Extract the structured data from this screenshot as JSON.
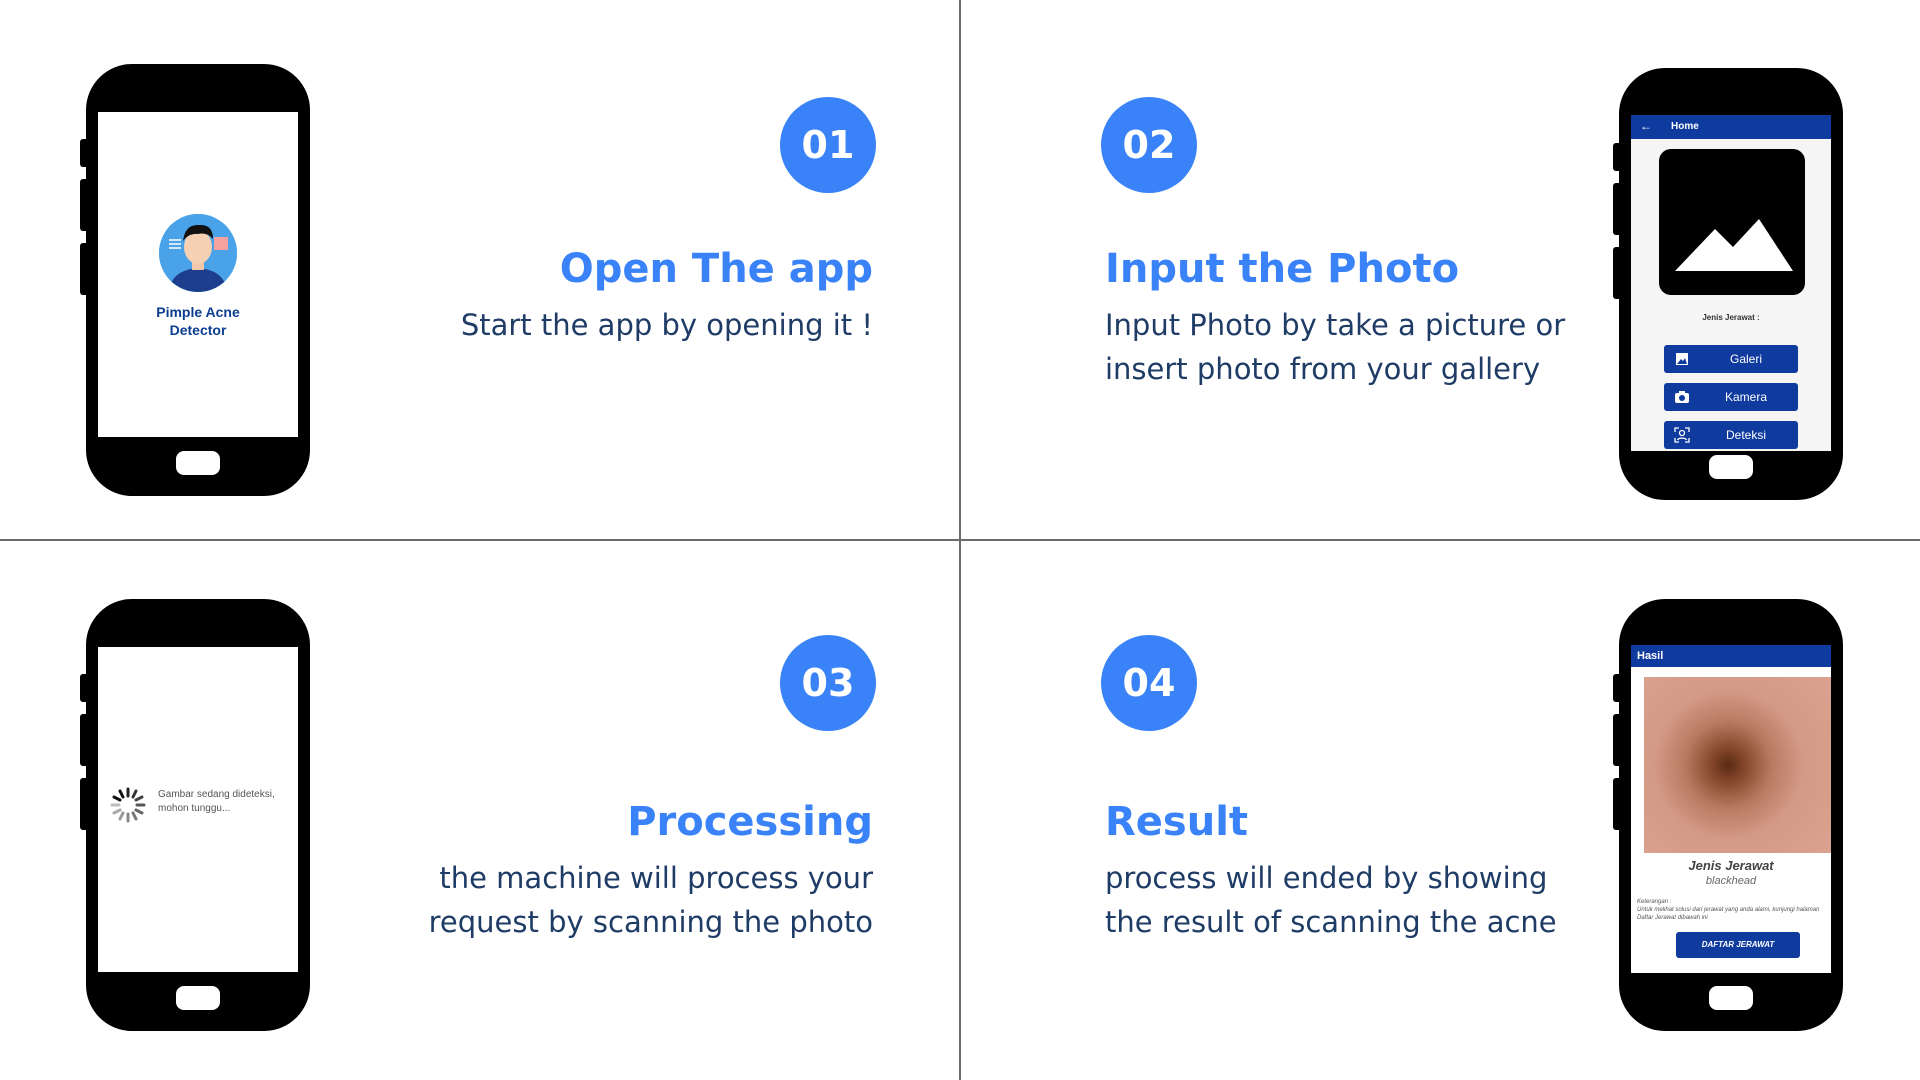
{
  "steps": [
    {
      "number": "01",
      "title": "Open The app",
      "description": [
        "Start the app by opening it !"
      ]
    },
    {
      "number": "02",
      "title": "Input the Photo",
      "description": [
        "Input Photo by take a picture or",
        "insert photo from your gallery"
      ]
    },
    {
      "number": "03",
      "title": "Processing",
      "description": [
        "the machine will process your",
        "request by scanning the photo"
      ]
    },
    {
      "number": "04",
      "title": "Result",
      "description": [
        "process will ended by showing",
        "the result of scanning the acne"
      ]
    }
  ],
  "phone1": {
    "app_name_line1": "Pimple Acne",
    "app_name_line2": "Detector"
  },
  "phone2": {
    "appbar_title": "Home",
    "jenis_label": "Jenis Jerawat :",
    "buttons": [
      {
        "label": "Galeri",
        "icon": "image-icon"
      },
      {
        "label": "Kamera",
        "icon": "camera-icon"
      },
      {
        "label": "Deteksi",
        "icon": "face-scan-icon"
      }
    ]
  },
  "phone3": {
    "loading_line1": "Gambar sedang dideteksi,",
    "loading_line2": "mohon tunggu..."
  },
  "phone4": {
    "appbar_title": "Hasil",
    "jenis_label": "Jenis Jerawat",
    "jenis_value": "blackhead",
    "keterangan_label": "Keterangan :",
    "keterangan_text": "Untuk melihat solusi dari jerawat yang anda alami, kunjungi halaman Daftar Jerawat dibawah ini",
    "button_label": "DAFTAR JERAWAT"
  },
  "colors": {
    "accent": "#3a82f7",
    "text_dark": "#1f3c66",
    "app_primary": "#0f3a9e"
  }
}
